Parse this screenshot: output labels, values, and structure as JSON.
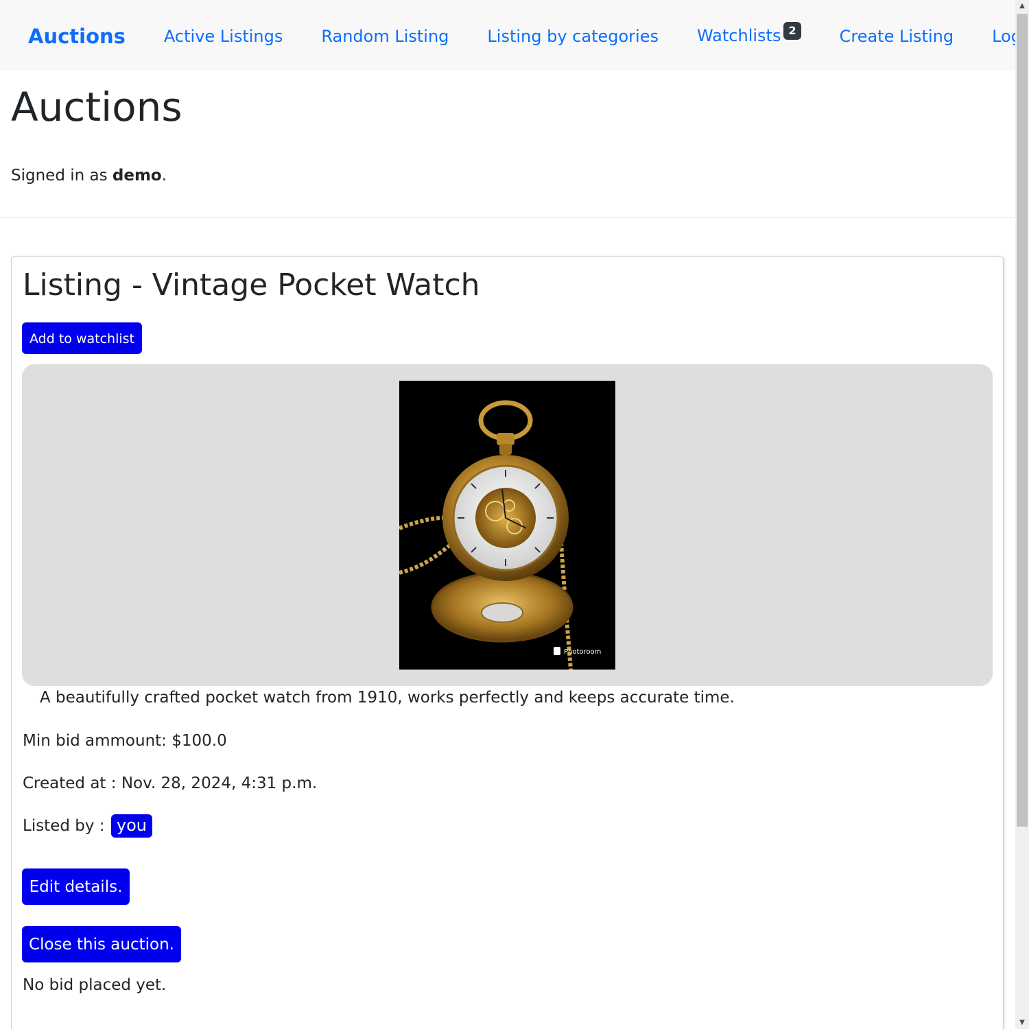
{
  "nav": {
    "brand": "Auctions",
    "links": [
      "Active Listings",
      "Random Listing",
      "Listing by categories",
      "Watchlists",
      "Create Listing",
      "Log Out"
    ],
    "watchlist_count": "2"
  },
  "header": {
    "title": "Auctions",
    "signed_in_prefix": "Signed in as ",
    "username": "demo",
    "signed_in_suffix": "."
  },
  "listing": {
    "title": "Listing - Vintage Pocket Watch",
    "watchlist_button": "Add to watchlist",
    "image_watermark": "Photoroom",
    "description": "A beautifully crafted pocket watch from 1910, works perfectly and keeps accurate time.",
    "min_bid": "Min bid ammount: $100.0",
    "created_at": "Created at : Nov. 28, 2024, 4:31 p.m.",
    "listed_by_label": "Listed by : ",
    "listed_by_user": "you",
    "edit_button": "Edit details.",
    "close_button": "Close this auction.",
    "bid_status": "No bid placed yet."
  },
  "colors": {
    "link": "#0d6efd",
    "button": "#0000ee",
    "navbar_bg": "#f8f8f8",
    "image_panel_bg": "#dedede"
  }
}
